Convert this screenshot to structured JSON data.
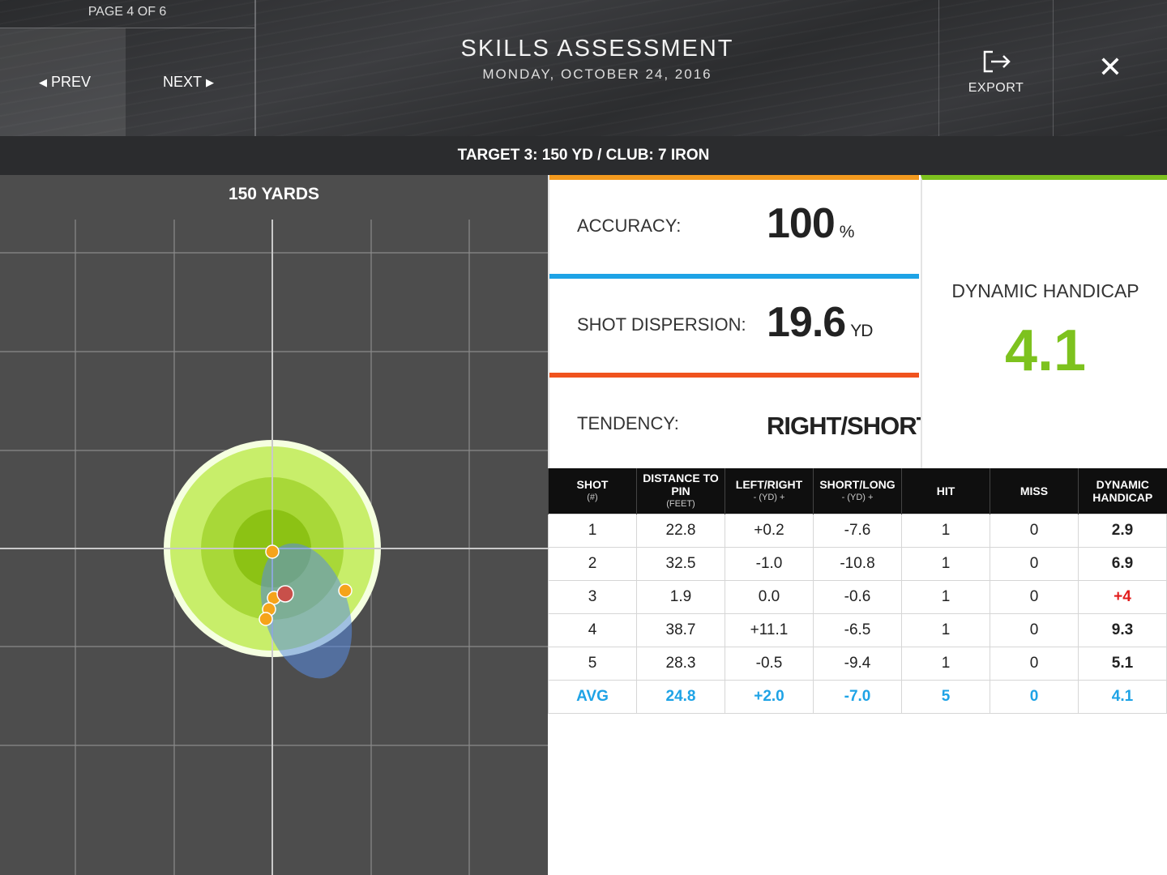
{
  "header": {
    "page_indicator": "PAGE 4 OF 6",
    "prev_label": "PREV",
    "next_label": "NEXT",
    "title": "SKILLS ASSESSMENT",
    "date": "MONDAY, OCTOBER 24, 2016",
    "export_label": "EXPORT",
    "close_symbol": "✕"
  },
  "target_bar": "TARGET 3: 150 YD / CLUB: 7 IRON",
  "map": {
    "title": "150 YARDS"
  },
  "stats": {
    "accuracy": {
      "label": "ACCURACY:",
      "value": "100",
      "unit": "%"
    },
    "dispersion": {
      "label": "SHOT DISPERSION:",
      "value": "19.6",
      "unit": "YD"
    },
    "tendency": {
      "label": "TENDENCY:",
      "value": "RIGHT/SHORT"
    },
    "handicap": {
      "label": "DYNAMIC HANDICAP",
      "value": "4.1"
    }
  },
  "colors": {
    "accuracy_bar": "#f39a1e",
    "dispersion_bar": "#1ea3e6",
    "tendency_bar": "#f0531e",
    "handicap_green": "#7dc21e",
    "avg_blue": "#1ea3e6",
    "over_par_red": "#e21c1c"
  },
  "table": {
    "headers": [
      {
        "main": "SHOT",
        "sub": "(#)"
      },
      {
        "main": "DISTANCE TO PIN",
        "sub": "(FEET)"
      },
      {
        "main": "LEFT/RIGHT",
        "sub": "- (YD) +"
      },
      {
        "main": "SHORT/LONG",
        "sub": "- (YD) +"
      },
      {
        "main": "HIT",
        "sub": ""
      },
      {
        "main": "MISS",
        "sub": ""
      },
      {
        "main": "DYNAMIC HANDICAP",
        "sub": ""
      }
    ],
    "rows": [
      [
        "1",
        "22.8",
        "+0.2",
        "-7.6",
        "1",
        "0",
        "2.9"
      ],
      [
        "2",
        "32.5",
        "-1.0",
        "-10.8",
        "1",
        "0",
        "6.9"
      ],
      [
        "3",
        "1.9",
        "0.0",
        "-0.6",
        "1",
        "0",
        "+4"
      ],
      [
        "4",
        "38.7",
        "+11.1",
        "-6.5",
        "1",
        "0",
        "9.3"
      ],
      [
        "5",
        "28.3",
        "-0.5",
        "-9.4",
        "1",
        "0",
        "5.1"
      ],
      [
        "AVG",
        "24.8",
        "+2.0",
        "-7.0",
        "5",
        "0",
        "4.1"
      ]
    ]
  }
}
